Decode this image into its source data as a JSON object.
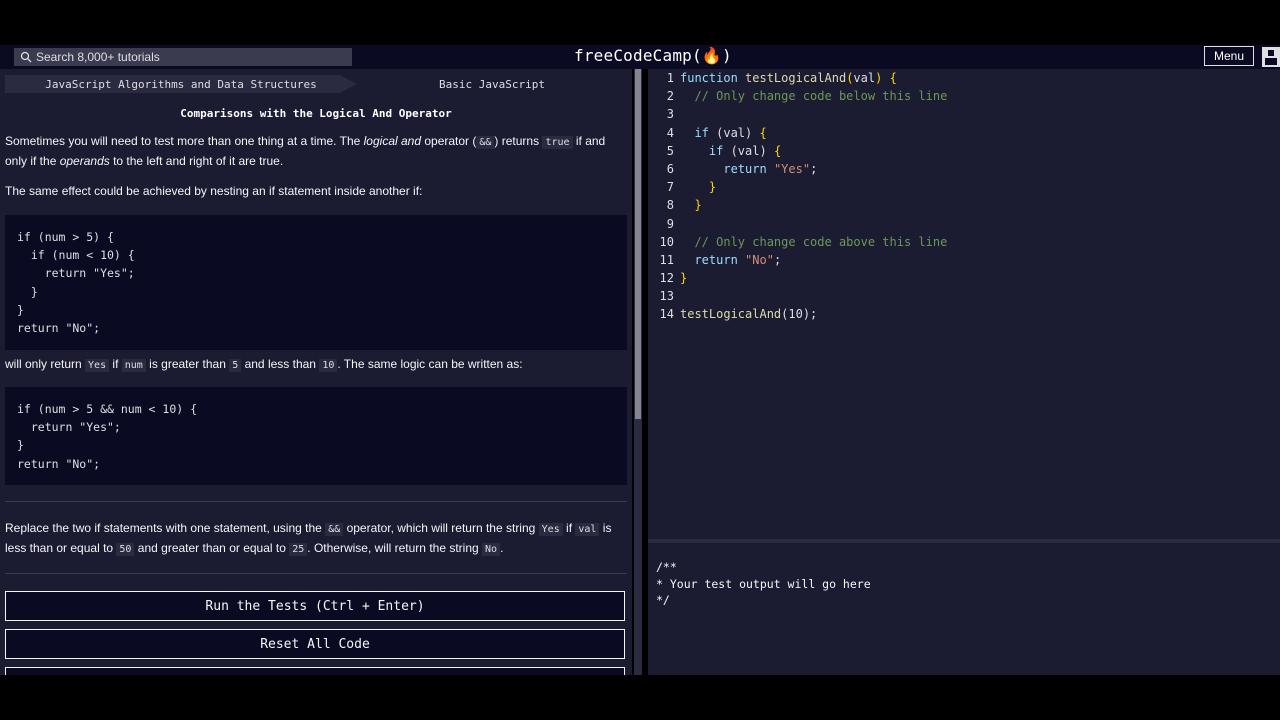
{
  "header": {
    "search_placeholder": "Search 8,000+ tutorials",
    "brand": "freeCodeCamp(🔥)",
    "menu_label": "Menu"
  },
  "breadcrumbs": [
    "JavaScript Algorithms and Data Structures",
    "Basic JavaScript"
  ],
  "challenge": {
    "title": "Comparisons with the Logical And Operator",
    "p1_parts": {
      "a": "Sometimes you will need to test more than one thing at a time. The ",
      "b": "logical and",
      "c": " operator (",
      "d": "&&",
      "e": ") returns ",
      "f": "true",
      "g": " if and only if the ",
      "h": "operands",
      "i": " to the left and right of it are true."
    },
    "p2": "The same effect could be achieved by nesting an if statement inside another if:",
    "code1": "if (num > 5) {\n  if (num < 10) {\n    return \"Yes\";\n  }\n}\nreturn \"No\";",
    "p3_parts": {
      "a": "will only return ",
      "b": "Yes",
      "c": " if ",
      "d": "num",
      "e": " is greater than ",
      "f": "5",
      "g": " and less than ",
      "h": "10",
      "i": ". The same logic can be written as:"
    },
    "code2": "if (num > 5 && num < 10) {\n  return \"Yes\";\n}\nreturn \"No\";",
    "p4_parts": {
      "a": "Replace the two if statements with one statement, using the ",
      "b": "&&",
      "c": " operator, which will return the string ",
      "d": "Yes",
      "e": " if ",
      "f": "val",
      "g": " is less than or equal to ",
      "h": "50",
      "i": " and greater than or equal to ",
      "j": "25",
      "k": ". Otherwise, will return the string ",
      "l": "No",
      "m": "."
    }
  },
  "buttons": {
    "run": "Run the Tests (Ctrl + Enter)",
    "reset": "Reset All Code"
  },
  "editor": {
    "line_numbers": [
      "1",
      "2",
      "3",
      "4",
      "5",
      "6",
      "7",
      "8",
      "9",
      "10",
      "11",
      "12",
      "13",
      "14"
    ]
  },
  "output": {
    "text": "/**\n* Your test output will go here\n*/"
  }
}
